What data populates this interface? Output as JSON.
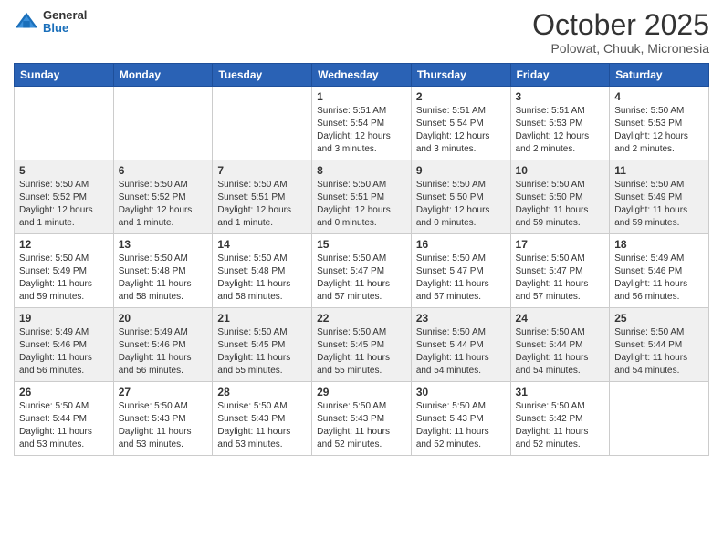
{
  "header": {
    "logo": {
      "general": "General",
      "blue": "Blue"
    },
    "title": "October 2025",
    "location": "Polowat, Chuuk, Micronesia"
  },
  "calendar": {
    "weekdays": [
      "Sunday",
      "Monday",
      "Tuesday",
      "Wednesday",
      "Thursday",
      "Friday",
      "Saturday"
    ],
    "weeks": [
      [
        {
          "day": "",
          "info": ""
        },
        {
          "day": "",
          "info": ""
        },
        {
          "day": "",
          "info": ""
        },
        {
          "day": "1",
          "info": "Sunrise: 5:51 AM\nSunset: 5:54 PM\nDaylight: 12 hours and 3 minutes."
        },
        {
          "day": "2",
          "info": "Sunrise: 5:51 AM\nSunset: 5:54 PM\nDaylight: 12 hours and 3 minutes."
        },
        {
          "day": "3",
          "info": "Sunrise: 5:51 AM\nSunset: 5:53 PM\nDaylight: 12 hours and 2 minutes."
        },
        {
          "day": "4",
          "info": "Sunrise: 5:50 AM\nSunset: 5:53 PM\nDaylight: 12 hours and 2 minutes."
        }
      ],
      [
        {
          "day": "5",
          "info": "Sunrise: 5:50 AM\nSunset: 5:52 PM\nDaylight: 12 hours and 1 minute."
        },
        {
          "day": "6",
          "info": "Sunrise: 5:50 AM\nSunset: 5:52 PM\nDaylight: 12 hours and 1 minute."
        },
        {
          "day": "7",
          "info": "Sunrise: 5:50 AM\nSunset: 5:51 PM\nDaylight: 12 hours and 1 minute."
        },
        {
          "day": "8",
          "info": "Sunrise: 5:50 AM\nSunset: 5:51 PM\nDaylight: 12 hours and 0 minutes."
        },
        {
          "day": "9",
          "info": "Sunrise: 5:50 AM\nSunset: 5:50 PM\nDaylight: 12 hours and 0 minutes."
        },
        {
          "day": "10",
          "info": "Sunrise: 5:50 AM\nSunset: 5:50 PM\nDaylight: 11 hours and 59 minutes."
        },
        {
          "day": "11",
          "info": "Sunrise: 5:50 AM\nSunset: 5:49 PM\nDaylight: 11 hours and 59 minutes."
        }
      ],
      [
        {
          "day": "12",
          "info": "Sunrise: 5:50 AM\nSunset: 5:49 PM\nDaylight: 11 hours and 59 minutes."
        },
        {
          "day": "13",
          "info": "Sunrise: 5:50 AM\nSunset: 5:48 PM\nDaylight: 11 hours and 58 minutes."
        },
        {
          "day": "14",
          "info": "Sunrise: 5:50 AM\nSunset: 5:48 PM\nDaylight: 11 hours and 58 minutes."
        },
        {
          "day": "15",
          "info": "Sunrise: 5:50 AM\nSunset: 5:47 PM\nDaylight: 11 hours and 57 minutes."
        },
        {
          "day": "16",
          "info": "Sunrise: 5:50 AM\nSunset: 5:47 PM\nDaylight: 11 hours and 57 minutes."
        },
        {
          "day": "17",
          "info": "Sunrise: 5:50 AM\nSunset: 5:47 PM\nDaylight: 11 hours and 57 minutes."
        },
        {
          "day": "18",
          "info": "Sunrise: 5:49 AM\nSunset: 5:46 PM\nDaylight: 11 hours and 56 minutes."
        }
      ],
      [
        {
          "day": "19",
          "info": "Sunrise: 5:49 AM\nSunset: 5:46 PM\nDaylight: 11 hours and 56 minutes."
        },
        {
          "day": "20",
          "info": "Sunrise: 5:49 AM\nSunset: 5:46 PM\nDaylight: 11 hours and 56 minutes."
        },
        {
          "day": "21",
          "info": "Sunrise: 5:50 AM\nSunset: 5:45 PM\nDaylight: 11 hours and 55 minutes."
        },
        {
          "day": "22",
          "info": "Sunrise: 5:50 AM\nSunset: 5:45 PM\nDaylight: 11 hours and 55 minutes."
        },
        {
          "day": "23",
          "info": "Sunrise: 5:50 AM\nSunset: 5:44 PM\nDaylight: 11 hours and 54 minutes."
        },
        {
          "day": "24",
          "info": "Sunrise: 5:50 AM\nSunset: 5:44 PM\nDaylight: 11 hours and 54 minutes."
        },
        {
          "day": "25",
          "info": "Sunrise: 5:50 AM\nSunset: 5:44 PM\nDaylight: 11 hours and 54 minutes."
        }
      ],
      [
        {
          "day": "26",
          "info": "Sunrise: 5:50 AM\nSunset: 5:44 PM\nDaylight: 11 hours and 53 minutes."
        },
        {
          "day": "27",
          "info": "Sunrise: 5:50 AM\nSunset: 5:43 PM\nDaylight: 11 hours and 53 minutes."
        },
        {
          "day": "28",
          "info": "Sunrise: 5:50 AM\nSunset: 5:43 PM\nDaylight: 11 hours and 53 minutes."
        },
        {
          "day": "29",
          "info": "Sunrise: 5:50 AM\nSunset: 5:43 PM\nDaylight: 11 hours and 52 minutes."
        },
        {
          "day": "30",
          "info": "Sunrise: 5:50 AM\nSunset: 5:43 PM\nDaylight: 11 hours and 52 minutes."
        },
        {
          "day": "31",
          "info": "Sunrise: 5:50 AM\nSunset: 5:42 PM\nDaylight: 11 hours and 52 minutes."
        },
        {
          "day": "",
          "info": ""
        }
      ]
    ]
  }
}
